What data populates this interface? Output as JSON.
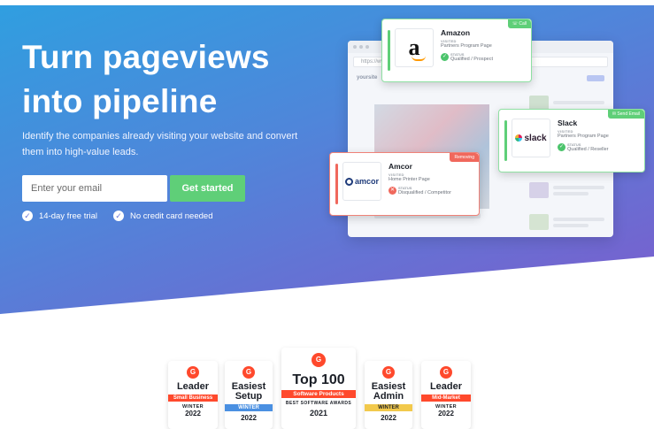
{
  "hero": {
    "headline": "Turn pageviews into pipeline",
    "subtitle": "Identify the companies already visiting your website and convert them into high-value leads.",
    "email_placeholder": "Enter your email",
    "cta_label": "Get started",
    "perks": [
      "14-day free trial",
      "No credit card needed"
    ],
    "colors": {
      "gradient_start": "#2f9fe0",
      "gradient_end": "#8a55c7",
      "cta": "#5fcf78"
    }
  },
  "browser": {
    "url": "https://ww",
    "logo": "yoursite"
  },
  "cards": {
    "amazon": {
      "name": "Amazon",
      "visited_label": "VISITED",
      "visited": "Partners Program Page",
      "status_label": "STATUS",
      "status": "Qualified / Prospect",
      "tag": "Call",
      "status_color": "#4cc46c"
    },
    "slack": {
      "name": "Slack",
      "visited_label": "VISITED",
      "visited": "Partners Program Page",
      "status_label": "STATUS",
      "status": "Qualified / Reseller",
      "tag": "Send Email",
      "logo_text": "slack",
      "status_color": "#4cc46c"
    },
    "amcor": {
      "name": "Amcor",
      "visited_label": "VISITED",
      "visited": "Home Printer Page",
      "status_label": "STATUS",
      "status": "Disqualified / Competitor",
      "tag": "Removing",
      "logo_text": "amcor",
      "status_color": "#f0685c"
    }
  },
  "badges": [
    {
      "title_l1": "Leader",
      "title_l2": "",
      "band": "Small Business",
      "season": "WINTER",
      "year": "2022",
      "band_color": "#ff492c"
    },
    {
      "title_l1": "Easiest",
      "title_l2": "Setup",
      "band": "WINTER",
      "season": "",
      "year": "2022",
      "band_color": "#4a90e2"
    },
    {
      "title_l1": "Top 100",
      "title_l2": "",
      "band": "Software Products",
      "season": "BEST SOFTWARE AWARDS",
      "year": "2021",
      "band_color": "#ff492c"
    },
    {
      "title_l1": "Easiest",
      "title_l2": "Admin",
      "band": "WINTER",
      "season": "",
      "year": "2022",
      "band_color": "#f2c94c"
    },
    {
      "title_l1": "Leader",
      "title_l2": "",
      "band": "Mid-Market",
      "season": "WINTER",
      "year": "2022",
      "band_color": "#ff492c"
    }
  ]
}
